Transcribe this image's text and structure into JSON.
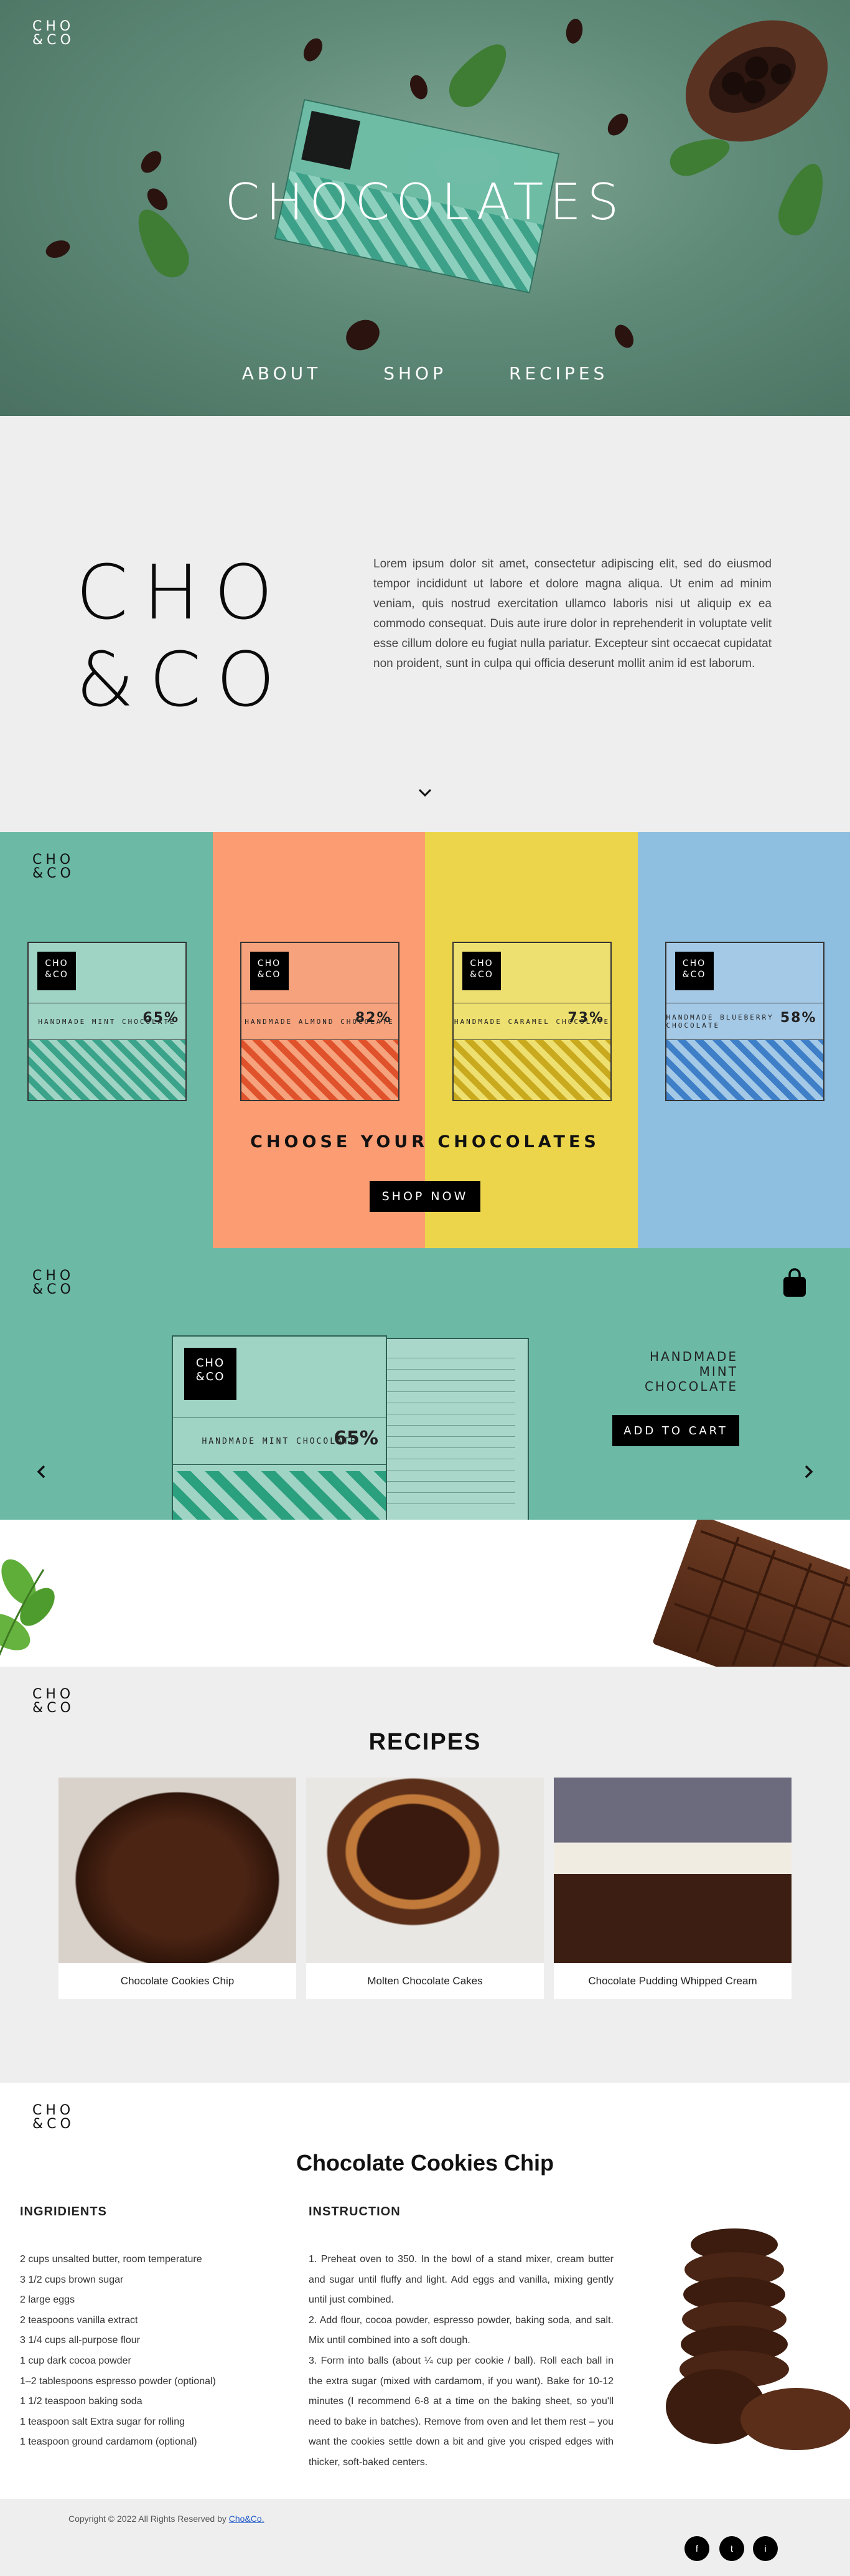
{
  "brand": {
    "logo_line1": "CHO",
    "logo_line2": "&CO"
  },
  "hero": {
    "title": "CHOCOLATES",
    "nav": [
      "ABOUT",
      "SHOP",
      "RECIPES"
    ]
  },
  "about": {
    "text": "Lorem ipsum dolor sit amet, consectetur adipiscing elit, sed do eiusmod tempor incididunt ut labore et dolore magna aliqua. Ut enim ad minim veniam, quis nostrud exercitation ullamco laboris nisi ut aliquip ex ea commodo consequat. Duis aute irure dolor in reprehenderit in voluptate velit esse cillum dolore eu fugiat nulla pariatur. Excepteur sint occaecat cupidatat non proident, sunt in culpa qui officia deserunt mollit anim id est laborum."
  },
  "products": {
    "title": "CHOOSE YOUR CHOCOLATES",
    "shop_label": "SHOP NOW",
    "items": [
      {
        "color": "#6cbaa6",
        "box": "#9fd3c3",
        "pattern": "#3aa38a",
        "label": "HANDMADE MINT CHOCOLATE",
        "pct": "65%"
      },
      {
        "color": "#fb9c72",
        "box": "#f5a27d",
        "pattern": "#e0522b",
        "label": "HANDMADE ALMOND CHOCOLATE",
        "pct": "82%"
      },
      {
        "color": "#ecd54b",
        "box": "#eee070",
        "pattern": "#c9a91d",
        "label": "HANDMADE CARAMEL CHOCOLATE",
        "pct": "73%"
      },
      {
        "color": "#8ebfe0",
        "box": "#a4c9e6",
        "pattern": "#3e7fc8",
        "label": "HANDMADE BLUEBERRY CHOCOLATE",
        "pct": "58%"
      }
    ]
  },
  "detail": {
    "name_line1": "HANDMADE",
    "name_line2": "MINT",
    "name_line3": "CHOCOLATE",
    "cart_label": "ADD TO CART",
    "box_label": "HANDMADE MINT CHOCOLATE",
    "box_pct": "65%"
  },
  "recipes": {
    "title": "RECIPES",
    "cards": [
      {
        "caption": "Chocolate Cookies Chip"
      },
      {
        "caption": "Molten Chocolate Cakes"
      },
      {
        "caption": "Chocolate Pudding Whipped Cream"
      }
    ]
  },
  "recipe_detail": {
    "title": "Chocolate Cookies Chip",
    "ingredients_heading": "INGRIDIENTS",
    "instruction_heading": "INSTRUCTION",
    "ingredients": [
      "2 cups unsalted butter, room temperature",
      "3 1/2 cups brown sugar",
      "2 large eggs",
      "2 teaspoons vanilla extract",
      "3 1/4 cups all-purpose flour",
      "1 cup dark cocoa powder",
      "1–2 tablespoons espresso powder (optional)",
      "1 1/2 teaspoon baking soda",
      "1 teaspoon salt Extra sugar for rolling",
      "1 teaspoon ground cardamom (optional)"
    ],
    "instructions": [
      "1. Preheat oven to 350. In the bowl of a stand mixer, cream butter and sugar until fluffy and light. Add eggs and vanilla, mixing gently until just combined.",
      "2. Add flour, cocoa powder, espresso powder, baking soda, and salt. Mix until combined into a soft dough.",
      "3. Form into balls (about ¼ cup per cookie / ball). Roll each ball in the extra sugar (mixed with cardamom, if you want). Bake for 10-12 minutes (I recommend 6-8 at a time on the baking sheet, so you'll need to bake in batches). Remove from oven and let them rest – you want the cookies settle down a bit and give you crisped edges with thicker, soft-baked centers."
    ]
  },
  "footer": {
    "copyright": "Copyright © 2022 All Rights Reserved by",
    "copyright_link": "Cho&Co.",
    "social": [
      "f",
      "t",
      "i"
    ]
  }
}
